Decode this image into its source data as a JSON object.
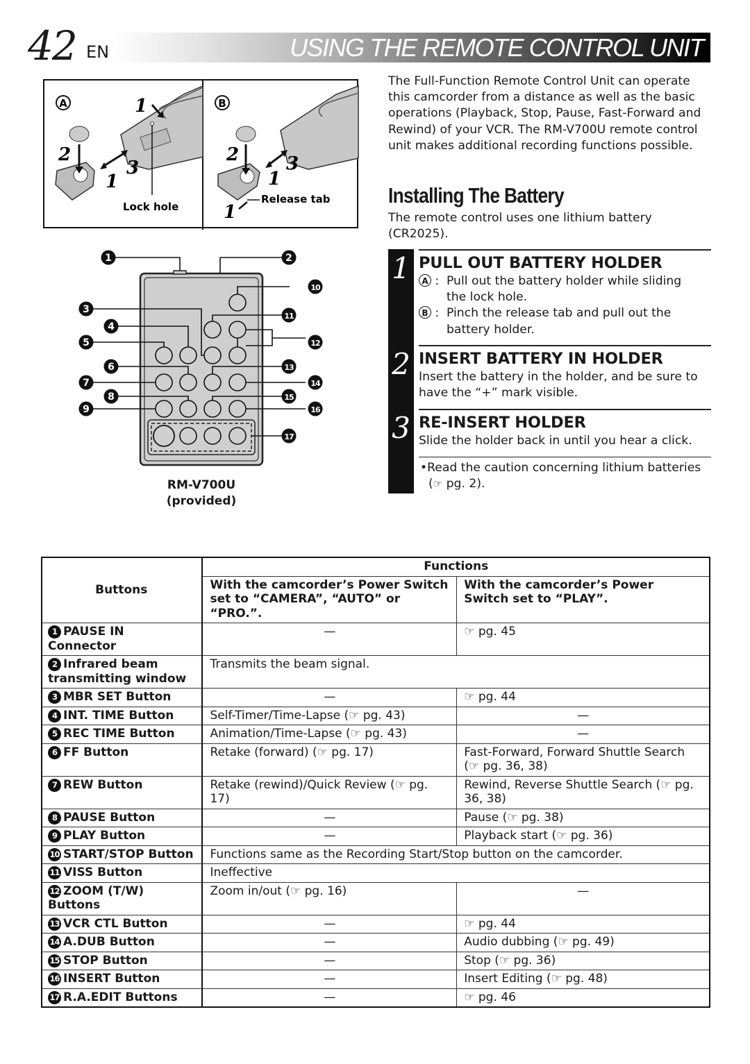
{
  "header": {
    "page_number": "42",
    "language": "EN",
    "title": "USING THE REMOTE CONTROL UNIT"
  },
  "battery_figure": {
    "panel_a_label": "A",
    "panel_b_label": "B",
    "lock_hole_label": "Lock hole",
    "release_tab_label": "Release tab",
    "step_markers": [
      "1",
      "2",
      "3"
    ]
  },
  "remote_figure": {
    "model": "RM-V700U",
    "note": "(provided)",
    "callouts": [
      "1",
      "2",
      "3",
      "4",
      "5",
      "6",
      "7",
      "8",
      "9",
      "10",
      "11",
      "12",
      "13",
      "14",
      "15",
      "16",
      "17"
    ]
  },
  "intro_text": "The Full-Function Remote Control Unit can operate this camcorder from a distance as well as the basic operations (Playback, Stop, Pause, Fast-Forward and Rewind) of your VCR. The RM-V700U remote control unit makes additional recording functions possible.",
  "section": {
    "title": "Installing The Battery",
    "intro": "The remote control uses one lithium battery (CR2025)."
  },
  "steps": [
    {
      "number": "1",
      "heading": "PULL OUT BATTERY HOLDER",
      "items": [
        {
          "label": "A",
          "text_line1": "Pull out the battery holder while sliding",
          "text_line2": "the lock hole."
        },
        {
          "label": "B",
          "text_line1": "Pinch the release tab and pull out the",
          "text_line2": "battery holder."
        }
      ]
    },
    {
      "number": "2",
      "heading": "INSERT BATTERY IN HOLDER",
      "text": "Insert the battery in the holder, and be sure to have the “+” mark visible."
    },
    {
      "number": "3",
      "heading": "RE-INSERT HOLDER",
      "text": "Slide the holder back in until you hear a click."
    }
  ],
  "caution_note": {
    "bullet": "•",
    "text": "Read the caution concerning lithium batteries",
    "ref_icon": "☞",
    "ref": "pg. 2)."
  },
  "table": {
    "col_buttons": "Buttons",
    "col_functions": "Functions",
    "col_camera": "With the camcorder’s Power Switch set to “CAMERA”, “AUTO” or “PRO.”.",
    "col_play": "With the camcorder’s Power Switch set to “PLAY”.",
    "ref_icon": "☞",
    "rows": [
      {
        "num": "1",
        "button": "PAUSE IN Connector",
        "camera": "—",
        "play": "☞ pg. 45"
      },
      {
        "num": "2",
        "button": "Infrared beam transmitting window",
        "span": "Transmits the beam signal."
      },
      {
        "num": "3",
        "button": "MBR SET Button",
        "camera": "—",
        "play": "☞ pg. 44"
      },
      {
        "num": "4",
        "button": "INT. TIME Button",
        "camera": "Self-Timer/Time-Lapse (☞ pg. 43)",
        "play": "—"
      },
      {
        "num": "5",
        "button": "REC TIME Button",
        "camera": "Animation/Time-Lapse (☞ pg. 43)",
        "play": "—"
      },
      {
        "num": "6",
        "button": "FF Button",
        "camera": "Retake (forward) (☞ pg. 17)",
        "play": "Fast-Forward, Forward Shuttle Search (☞ pg. 36, 38)"
      },
      {
        "num": "7",
        "button": "REW Button",
        "camera": "Retake (rewind)/Quick Review (☞ pg. 17)",
        "play": "Rewind, Reverse Shuttle Search (☞ pg. 36, 38)"
      },
      {
        "num": "8",
        "button": "PAUSE Button",
        "camera": "—",
        "play": "Pause (☞ pg. 38)"
      },
      {
        "num": "9",
        "button": "PLAY Button",
        "camera": "—",
        "play": "Playback start (☞ pg. 36)"
      },
      {
        "num": "10",
        "button": "START/STOP Button",
        "span": "Functions same as the Recording Start/Stop button on the camcorder."
      },
      {
        "num": "11",
        "button": "VISS Button",
        "span": "Ineffective"
      },
      {
        "num": "12",
        "button": "ZOOM (T/W) Buttons",
        "camera": "Zoom in/out (☞ pg. 16)",
        "play": "—"
      },
      {
        "num": "13",
        "button": "VCR CTL Button",
        "camera": "—",
        "play": "☞ pg. 44"
      },
      {
        "num": "14",
        "button": "A.DUB Button",
        "camera": "—",
        "play": "Audio dubbing (☞ pg. 49)"
      },
      {
        "num": "15",
        "button": "STOP Button",
        "camera": "—",
        "play": "Stop (☞ pg. 36)"
      },
      {
        "num": "16",
        "button": "INSERT Button",
        "camera": "—",
        "play": "Insert Editing (☞ pg. 48)"
      },
      {
        "num": "17",
        "button": "R.A.EDIT Buttons",
        "camera": "—",
        "play": "☞ pg. 46"
      }
    ]
  }
}
